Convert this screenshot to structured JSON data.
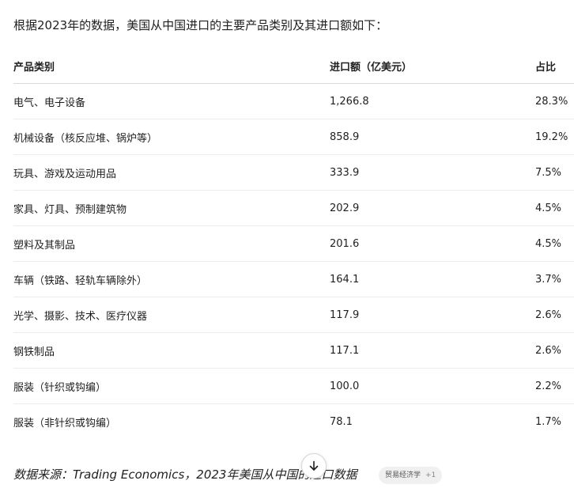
{
  "intro": "根据2023年的数据，美国从中国进口的主要产品类别及其进口额如下：",
  "table": {
    "headers": [
      "产品类别",
      "进口额（亿美元）",
      "占比"
    ],
    "rows": [
      [
        "电气、电子设备",
        "1,266.8",
        "28.3%"
      ],
      [
        "机械设备（核反应堆、锅炉等）",
        "858.9",
        "19.2%"
      ],
      [
        "玩具、游戏及运动用品",
        "333.9",
        "7.5%"
      ],
      [
        "家具、灯具、预制建筑物",
        "202.9",
        "4.5%"
      ],
      [
        "塑料及其制品",
        "201.6",
        "4.5%"
      ],
      [
        "车辆（铁路、轻轨车辆除外）",
        "164.1",
        "3.7%"
      ],
      [
        "光学、摄影、技术、医疗仪器",
        "117.9",
        "2.6%"
      ],
      [
        "钢铁制品",
        "117.1",
        "2.6%"
      ],
      [
        "服装（针织或钩编）",
        "100.0",
        "2.2%"
      ],
      [
        "服装（非针织或钩编）",
        "78.1",
        "1.7%"
      ]
    ]
  },
  "source": "数据来源：Trading Economics，2023年美国从中国的进口数据",
  "source_chip": {
    "label": "贸易经济学",
    "more": "+1"
  },
  "scroll_button": {
    "icon": "arrow-down-icon"
  }
}
